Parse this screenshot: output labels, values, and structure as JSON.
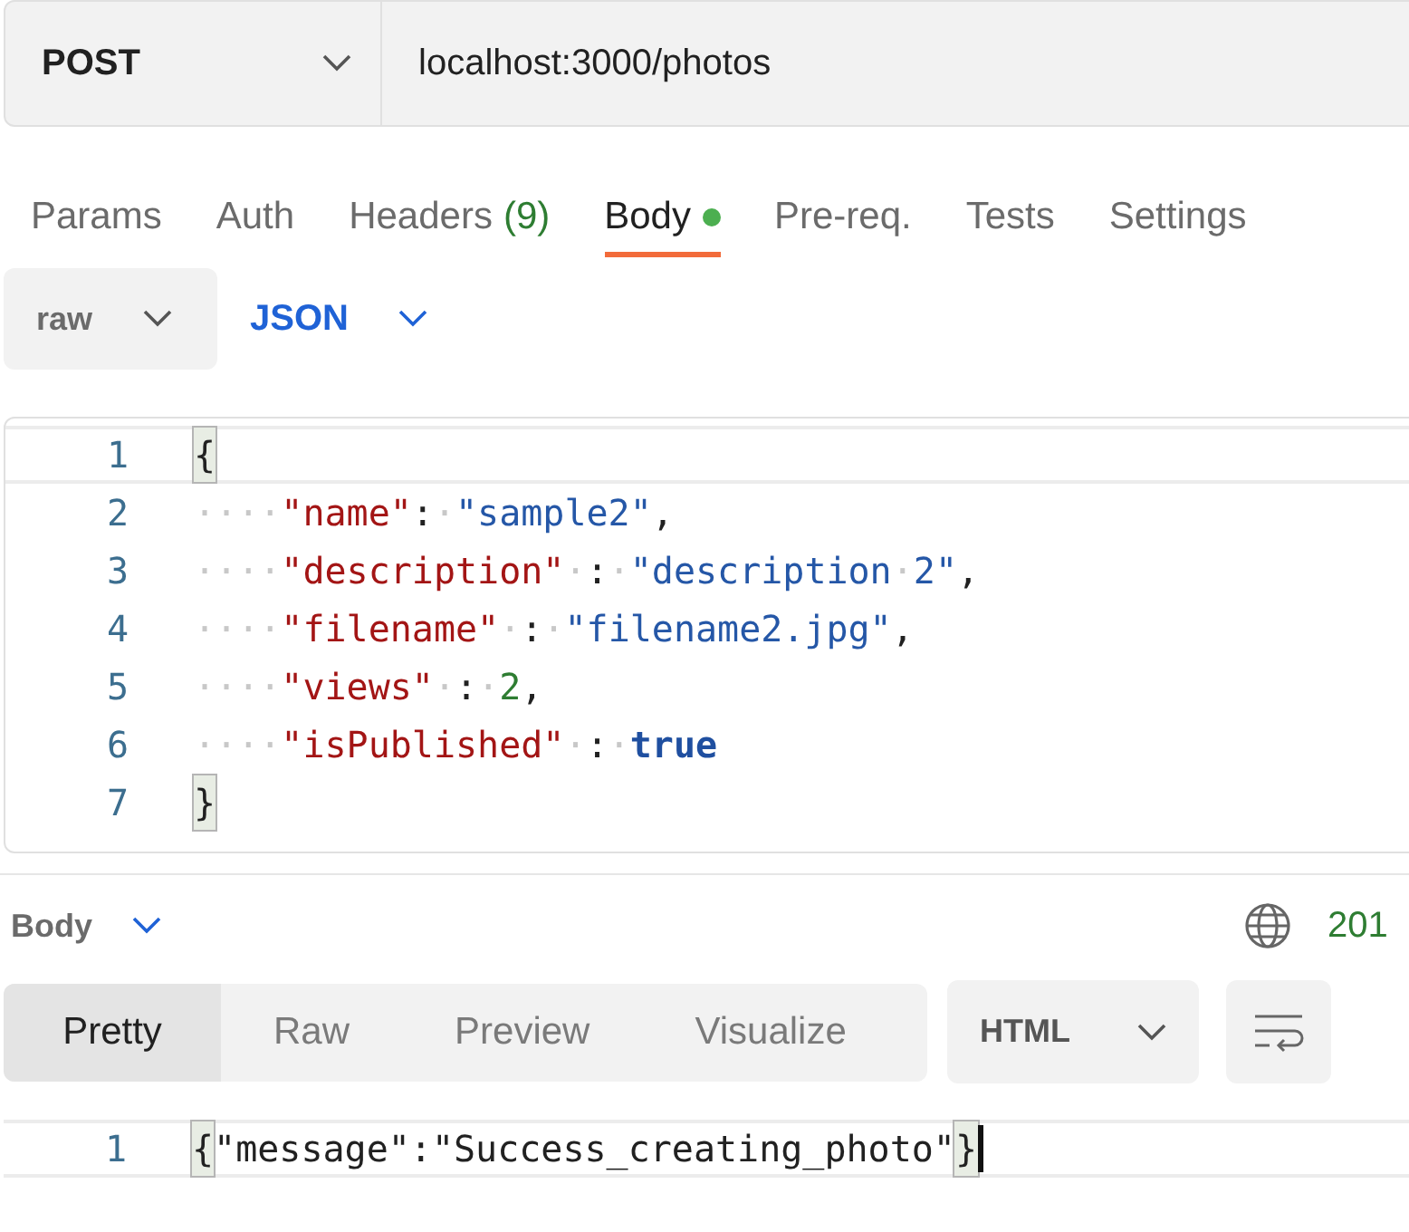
{
  "request": {
    "method": "POST",
    "url": "localhost:3000/photos"
  },
  "tabs": [
    {
      "label": "Params",
      "selected": false
    },
    {
      "label": "Auth",
      "selected": false
    },
    {
      "label": "Headers",
      "count": "(9)",
      "selected": false
    },
    {
      "label": "Body",
      "dot": true,
      "selected": true
    },
    {
      "label": "Pre-req.",
      "selected": false
    },
    {
      "label": "Tests",
      "selected": false
    },
    {
      "label": "Settings",
      "selected": false
    }
  ],
  "body_mode": {
    "type": "raw",
    "format": "JSON"
  },
  "editor": {
    "lines": [
      {
        "number": "1",
        "active": true,
        "tokens": [
          {
            "kind": "bracket_match",
            "text": "{"
          }
        ]
      },
      {
        "number": "2",
        "active": false,
        "tokens": [
          {
            "kind": "ws",
            "text": "····"
          },
          {
            "kind": "key",
            "text": "\"name\""
          },
          {
            "kind": "punct",
            "text": ":"
          },
          {
            "kind": "ws",
            "text": "·"
          },
          {
            "kind": "string",
            "text": "\"sample2\""
          },
          {
            "kind": "punct",
            "text": ","
          }
        ]
      },
      {
        "number": "3",
        "active": false,
        "tokens": [
          {
            "kind": "ws",
            "text": "····"
          },
          {
            "kind": "key",
            "text": "\"description\""
          },
          {
            "kind": "ws",
            "text": "·"
          },
          {
            "kind": "punct",
            "text": ":"
          },
          {
            "kind": "ws",
            "text": "·"
          },
          {
            "kind": "string",
            "text": "\"description"
          },
          {
            "kind": "ws",
            "text": "·"
          },
          {
            "kind": "string",
            "text": "2\""
          },
          {
            "kind": "punct",
            "text": ","
          }
        ]
      },
      {
        "number": "4",
        "active": false,
        "tokens": [
          {
            "kind": "ws",
            "text": "····"
          },
          {
            "kind": "key",
            "text": "\"filename\""
          },
          {
            "kind": "ws",
            "text": "·"
          },
          {
            "kind": "punct",
            "text": ":"
          },
          {
            "kind": "ws",
            "text": "·"
          },
          {
            "kind": "string",
            "text": "\"filename2.jpg\""
          },
          {
            "kind": "punct",
            "text": ","
          }
        ]
      },
      {
        "number": "5",
        "active": false,
        "tokens": [
          {
            "kind": "ws",
            "text": "····"
          },
          {
            "kind": "key",
            "text": "\"views\""
          },
          {
            "kind": "ws",
            "text": "·"
          },
          {
            "kind": "punct",
            "text": ":"
          },
          {
            "kind": "ws",
            "text": "·"
          },
          {
            "kind": "number",
            "text": "2"
          },
          {
            "kind": "punct",
            "text": ","
          }
        ]
      },
      {
        "number": "6",
        "active": false,
        "tokens": [
          {
            "kind": "ws",
            "text": "····"
          },
          {
            "kind": "key",
            "text": "\"isPublished\""
          },
          {
            "kind": "ws",
            "text": "·"
          },
          {
            "kind": "punct",
            "text": ":"
          },
          {
            "kind": "ws",
            "text": "·"
          },
          {
            "kind": "boolean",
            "text": "true"
          }
        ]
      },
      {
        "number": "7",
        "active": false,
        "tokens": [
          {
            "kind": "bracket_match",
            "text": "}"
          }
        ]
      }
    ]
  },
  "response": {
    "section": "Body",
    "status": "201",
    "view_tabs": [
      {
        "label": "Pretty",
        "selected": true
      },
      {
        "label": "Raw",
        "selected": false
      },
      {
        "label": "Preview",
        "selected": false
      },
      {
        "label": "Visualize",
        "selected": false
      }
    ],
    "format": "HTML",
    "lines": [
      {
        "number": "1",
        "active": true,
        "tokens": [
          {
            "kind": "bracket_match",
            "text": "{"
          },
          {
            "kind": "plain",
            "text": "\"message\":\"Success_creating_photo\""
          },
          {
            "kind": "bracket_match",
            "text": "}"
          }
        ]
      }
    ]
  }
}
